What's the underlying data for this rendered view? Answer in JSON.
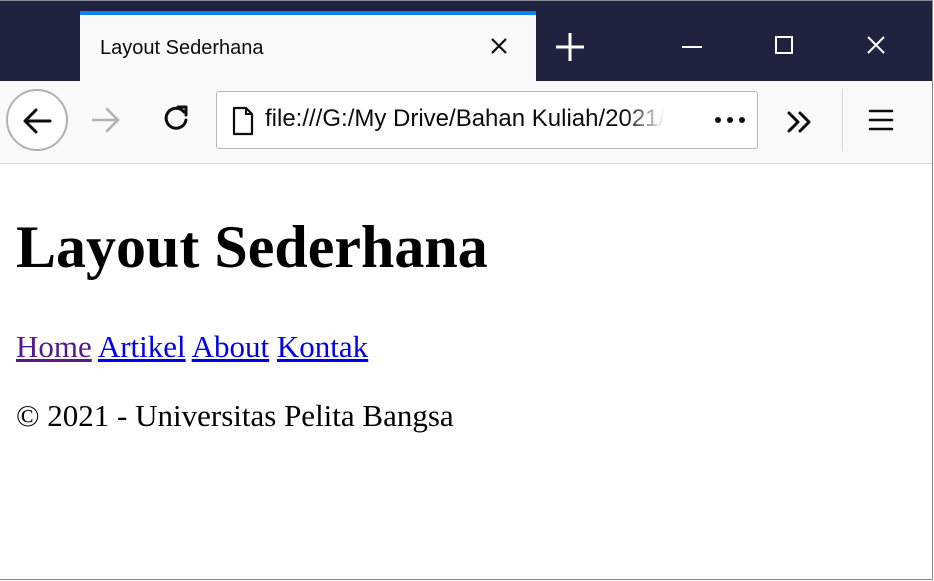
{
  "browser": {
    "tab": {
      "title": "Layout Sederhana"
    },
    "url": "file:///G:/My Drive/Bahan Kuliah/2021/",
    "colors": {
      "tabstrip": "#202340",
      "active_tab_accent": "#0a84ff",
      "toolbar": "#f9f9fa"
    },
    "icons": {
      "tab_close": "close-icon",
      "new_tab": "plus-icon",
      "minimize": "minimize-icon",
      "maximize": "maximize-icon",
      "window_close": "close-icon",
      "back": "back-arrow-icon",
      "forward": "forward-arrow-icon",
      "reload": "reload-icon",
      "page": "page-icon",
      "page_actions": "more-dots-icon",
      "overflow": "chevron-double-right-icon",
      "menu": "hamburger-menu-icon"
    }
  },
  "page": {
    "heading": "Layout Sederhana",
    "nav": [
      {
        "label": "Home",
        "visited": true
      },
      {
        "label": "Artikel",
        "visited": false
      },
      {
        "label": "About",
        "visited": false
      },
      {
        "label": "Kontak",
        "visited": false
      }
    ],
    "footer": "© 2021 - Universitas Pelita Bangsa",
    "colors": {
      "link": "#0000ee",
      "visited_link": "#551a8b"
    }
  }
}
